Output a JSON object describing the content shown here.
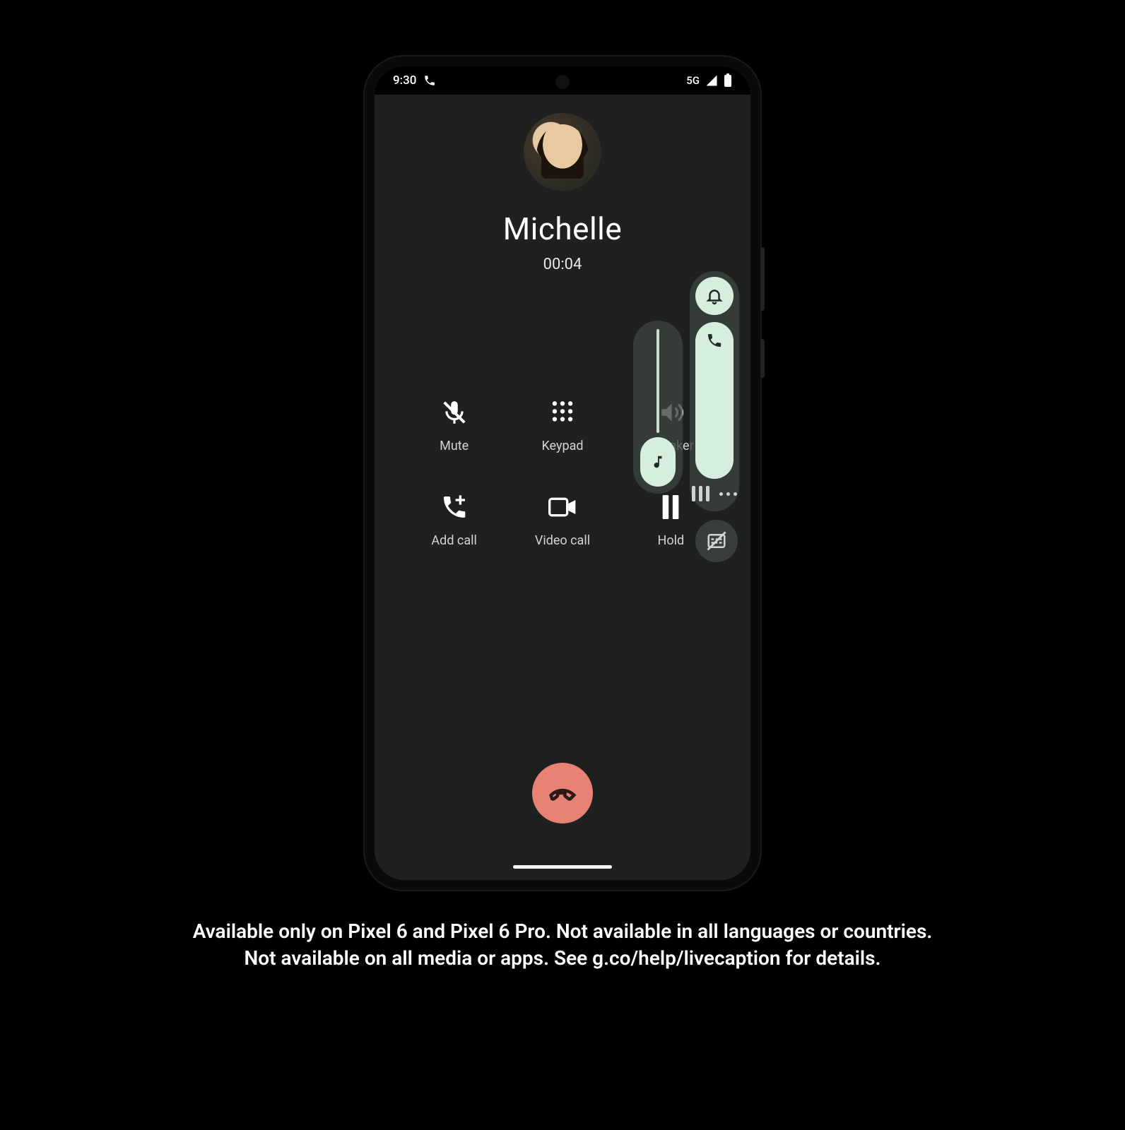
{
  "status_bar": {
    "time": "9:30",
    "network_label": "5G"
  },
  "call": {
    "caller_name": "Michelle",
    "duration": "00:04"
  },
  "buttons": {
    "mute": "Mute",
    "keypad": "Keypad",
    "speaker": "Speaker",
    "add_call": "Add call",
    "video_call": "Video call",
    "hold": "Hold"
  },
  "colors": {
    "screen_bg": "#1f2120",
    "accent_mint": "#d6eedd",
    "end_call_red": "#e88274"
  },
  "footnote_line1": "Available only on Pixel 6 and Pixel 6 Pro. Not available in all languages or countries.",
  "footnote_line2": "Not available on all media or apps. See g.co/help/livecaption for details."
}
